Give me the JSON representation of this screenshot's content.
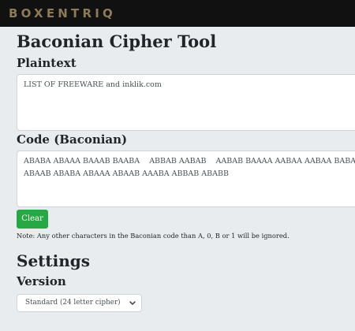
{
  "header": {
    "logo_text": "BOXENTRIQ"
  },
  "page": {
    "title": "Baconian Cipher Tool"
  },
  "plaintext": {
    "label": "Plaintext",
    "value": "LIST OF FREEWARE and inklik.com"
  },
  "code": {
    "label": "Code (Baconian)",
    "value": "ABABA ABAAA BAAAB BAABA    ABBAB AABAB    AABAB BAAAA AABAA AABAA BABAA AAAAA BAAAA AABAA    AAAAA\nABAAB ABABA ABAAA ABAAB AAABA ABBAB ABABB"
  },
  "actions": {
    "clear_label": "Clear"
  },
  "note": "Note: Any other characters in the Baconian code than A, 0, B or 1 will be ignored.",
  "settings": {
    "title": "Settings",
    "version_label": "Version",
    "version_selected": "Standard (24 letter cipher)",
    "dropdown_icon": "chevron-down-icon"
  },
  "colors": {
    "topbar_bg": "#111111",
    "logo": "#8c7a58",
    "page_bg": "#e9ecef",
    "clear_button": "#28a745"
  }
}
